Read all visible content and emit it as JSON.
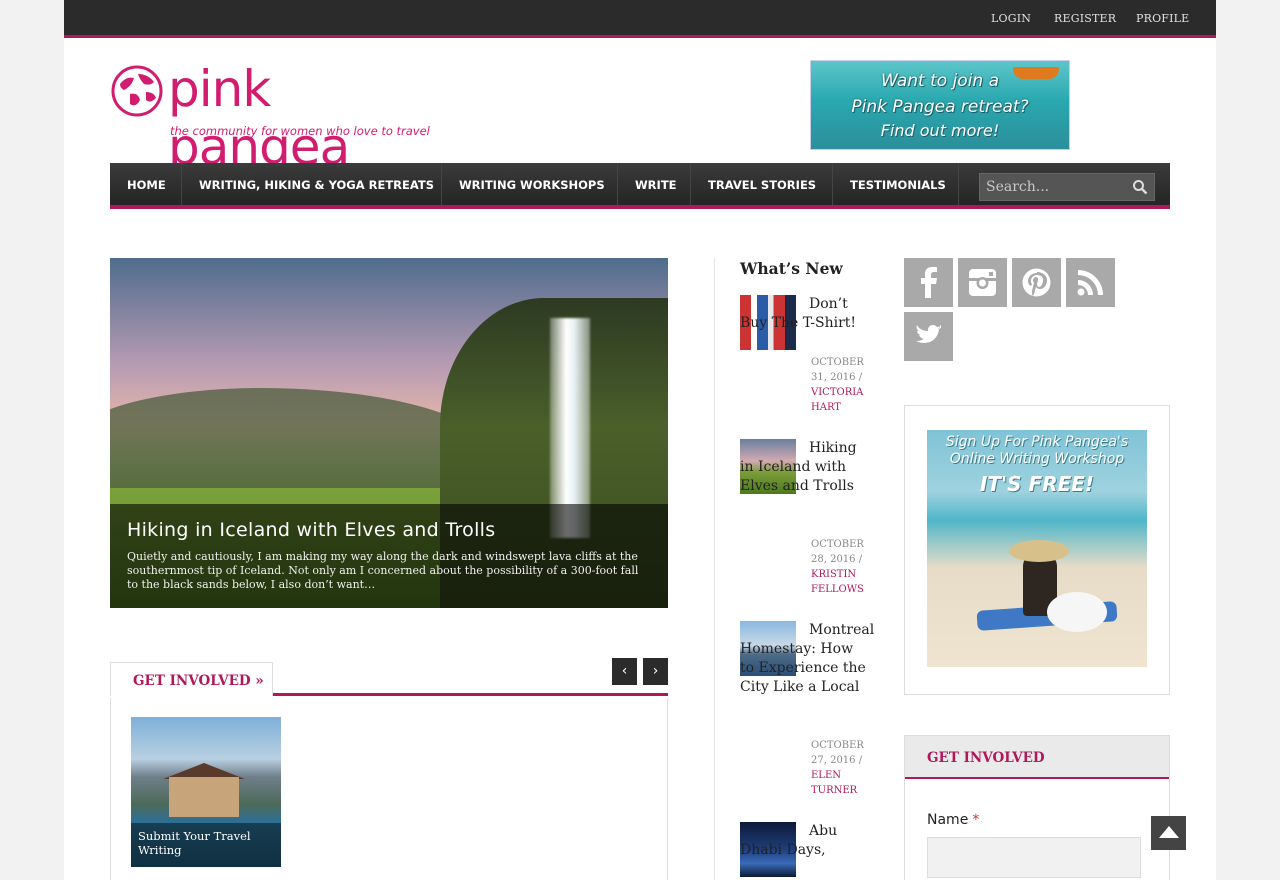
{
  "topbar": {
    "login": "LOGIN",
    "register": "REGISTER",
    "profile": "PROFILE"
  },
  "logo": {
    "name": "pink pangea",
    "tagline": "the community for women who love to travel"
  },
  "banner": {
    "line1": "Want to join a",
    "line2": "Pink Pangea retreat?",
    "line3": "Find out more!"
  },
  "nav": {
    "items": [
      {
        "label": "HOME"
      },
      {
        "label": "WRITING, HIKING & YOGA RETREATS"
      },
      {
        "label": "WRITING WORKSHOPS"
      },
      {
        "label": "WRITE"
      },
      {
        "label": "TRAVEL STORIES"
      },
      {
        "label": "TESTIMONIALS"
      }
    ],
    "search_placeholder": "Search..."
  },
  "slider": {
    "title": "Hiking in Iceland with Elves and Trolls",
    "excerpt": "Quietly and cautiously, I am making my way along the dark and windswept lava cliffs at the southernmost tip of Iceland. Not only am I concerned about the possibility of a 300-foot fall to the black sands below, I also don’t want…"
  },
  "get_involved": {
    "heading": "GET INVOLVED »",
    "prev": "‹",
    "next": "›",
    "card_label": "Submit Your Travel Writing"
  },
  "whats_new": {
    "title": "What’s New",
    "posts": [
      {
        "title": "Don’t Buy The T-Shirt!",
        "date": "OCTOBER 31, 2016 /",
        "author": "VICTORIA HART"
      },
      {
        "title": "Hiking in Iceland with Elves and Trolls",
        "date": "OCTOBER 28, 2016 /",
        "author": "KRISTIN FELLOWS"
      },
      {
        "title": "Montreal Homestay: How to Experience the City Like a Local",
        "date": "OCTOBER 27, 2016 /",
        "author": "ELEN TURNER"
      },
      {
        "title": "Abu Dhabi Days,",
        "date": "",
        "author": ""
      }
    ]
  },
  "social": {
    "icons": [
      "facebook-icon",
      "instagram-icon",
      "pinterest-icon",
      "rss-icon",
      "twitter-icon"
    ]
  },
  "sidebar_ad": {
    "line1": "Sign Up For Pink Pangea's Online Writing Workshop",
    "line2": "IT'S FREE!"
  },
  "sidebar_form": {
    "heading": "GET INVOLVED",
    "name_label": "Name",
    "required_mark": "*"
  },
  "colors": {
    "brand": "#b1185c",
    "logo_pink": "#d11d70",
    "dark": "#2b2b2b"
  }
}
